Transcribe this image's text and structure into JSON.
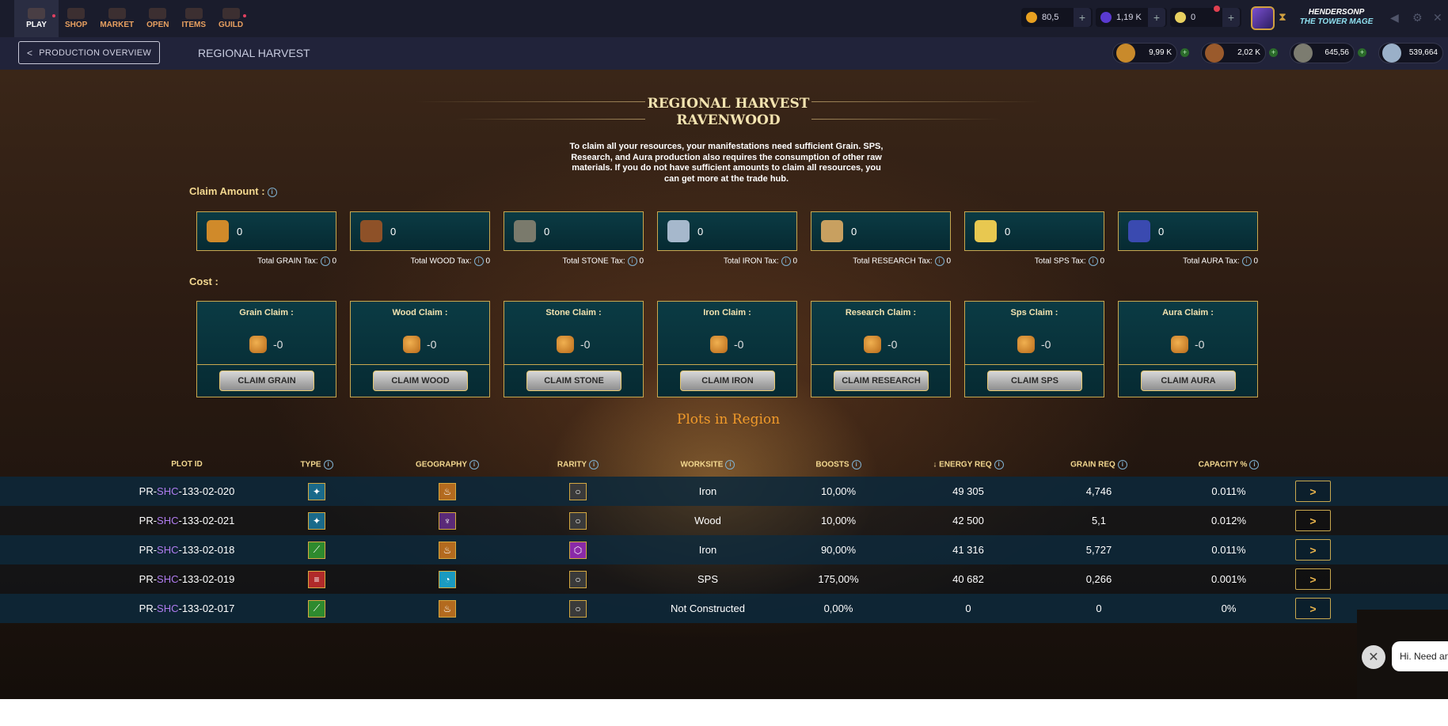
{
  "nav": {
    "items": [
      {
        "label": "PLAY",
        "active": true,
        "dot": true
      },
      {
        "label": "SHOP"
      },
      {
        "label": "MARKET"
      },
      {
        "label": "OPEN"
      },
      {
        "label": "ITEMS"
      },
      {
        "label": "GUILD",
        "dot": true
      }
    ]
  },
  "topbar": {
    "credits": "80,5",
    "dec": "1,19 K",
    "vouchers": "0",
    "username": "HENDERSONP",
    "user_title": "THE TOWER MAGE"
  },
  "subheader": {
    "back_label": "PRODUCTION OVERVIEW",
    "title": "REGIONAL HARVEST",
    "materials": [
      {
        "name": "grain",
        "value": "9,99 K",
        "color": "#c98a2b"
      },
      {
        "name": "wood",
        "value": "2,02 K",
        "color": "#9a5a2c"
      },
      {
        "name": "stone",
        "value": "645,56",
        "color": "#7c7c70"
      },
      {
        "name": "iron",
        "value": "539,664",
        "color": "#9ab0c8"
      }
    ]
  },
  "hero": {
    "title_line1": "REGIONAL HARVEST",
    "title_line2": "RAVENWOOD",
    "intro": "To claim all your resources, your manifestations need sufficient Grain. SPS, Research, and Aura production also requires the consumption of other raw materials. If you do not have sufficient amounts to claim all resources, you can get more at the trade hub."
  },
  "claim_amount": {
    "label": "Claim Amount :",
    "items": [
      {
        "resource": "grain",
        "amount": "0",
        "tax_label": "Total GRAIN Tax:",
        "tax": "0",
        "color": "#d08a2a"
      },
      {
        "resource": "wood",
        "amount": "0",
        "tax_label": "Total WOOD Tax:",
        "tax": "0",
        "color": "#8e5128"
      },
      {
        "resource": "stone",
        "amount": "0",
        "tax_label": "Total STONE Tax:",
        "tax": "0",
        "color": "#7a7a6c"
      },
      {
        "resource": "iron",
        "amount": "0",
        "tax_label": "Total IRON Tax:",
        "tax": "0",
        "color": "#a6b8cc"
      },
      {
        "resource": "research",
        "amount": "0",
        "tax_label": "Total RESEARCH Tax:",
        "tax": "0",
        "color": "#c8a060"
      },
      {
        "resource": "sps",
        "amount": "0",
        "tax_label": "Total SPS Tax:",
        "tax": "0",
        "color": "#e8c850"
      },
      {
        "resource": "aura",
        "amount": "0",
        "tax_label": "Total AURA Tax:",
        "tax": "0",
        "color": "#3a4ab0"
      }
    ]
  },
  "cost": {
    "label": "Cost :",
    "cards": [
      {
        "title": "Grain Claim :",
        "value": "-0",
        "button": "CLAIM GRAIN"
      },
      {
        "title": "Wood Claim :",
        "value": "-0",
        "button": "CLAIM WOOD"
      },
      {
        "title": "Stone Claim :",
        "value": "-0",
        "button": "CLAIM STONE"
      },
      {
        "title": "Iron Claim :",
        "value": "-0",
        "button": "CLAIM IRON"
      },
      {
        "title": "Research Claim :",
        "value": "-0",
        "button": "CLAIM RESEARCH"
      },
      {
        "title": "Sps Claim :",
        "value": "-0",
        "button": "CLAIM SPS"
      },
      {
        "title": "Aura Claim :",
        "value": "-0",
        "button": "CLAIM AURA"
      }
    ]
  },
  "plots": {
    "title": "Plots in Region",
    "columns": [
      "PLOT ID",
      "TYPE",
      "GEOGRAPHY",
      "RARITY",
      "WORKSITE",
      "BOOSTS",
      "ENERGY REQ",
      "GRAIN REQ",
      "CAPACITY %"
    ],
    "rows": [
      {
        "id_prefix": "PR-",
        "id_region": "SHC",
        "id_suffix": "-133-02-020",
        "type": "magic",
        "type_color": "#1a6a8a",
        "geo": "desert",
        "geo_color": "#b36a1e",
        "rarity": "common",
        "rarity_color": "#3a3a3a",
        "worksite": "Iron",
        "boosts": "10,00%",
        "energy": "49 305",
        "grain": "4,746",
        "capacity": "0.011%"
      },
      {
        "id_prefix": "PR-",
        "id_region": "SHC",
        "id_suffix": "-133-02-021",
        "type": "magic",
        "type_color": "#1a6a8a",
        "geo": "bog",
        "geo_color": "#5a2a78",
        "rarity": "common",
        "rarity_color": "#3a3a3a",
        "worksite": "Wood",
        "boosts": "10,00%",
        "energy": "42 500",
        "grain": "5,1",
        "capacity": "0.012%"
      },
      {
        "id_prefix": "PR-",
        "id_region": "SHC",
        "id_suffix": "-133-02-018",
        "type": "earth",
        "type_color": "#2e8a2e",
        "geo": "desert",
        "geo_color": "#b36a1e",
        "rarity": "epic",
        "rarity_color": "#8a2aa8",
        "worksite": "Iron",
        "boosts": "90,00%",
        "energy": "41 316",
        "grain": "5,727",
        "capacity": "0.011%"
      },
      {
        "id_prefix": "PR-",
        "id_region": "SHC",
        "id_suffix": "-133-02-019",
        "type": "fire",
        "type_color": "#b02a2a",
        "geo": "water",
        "geo_color": "#1a9ac0",
        "rarity": "common",
        "rarity_color": "#3a3a3a",
        "worksite": "SPS",
        "boosts": "175,00%",
        "energy": "40 682",
        "grain": "0,266",
        "capacity": "0.001%"
      },
      {
        "id_prefix": "PR-",
        "id_region": "SHC",
        "id_suffix": "-133-02-017",
        "type": "earth",
        "type_color": "#2e8a2e",
        "geo": "desert",
        "geo_color": "#b36a1e",
        "rarity": "common",
        "rarity_color": "#3a3a3a",
        "worksite": "Not Constructed",
        "boosts": "0,00%",
        "energy": "0",
        "grain": "0",
        "capacity": "0%"
      }
    ]
  },
  "chat": {
    "text": "Hi. Need any help?"
  }
}
